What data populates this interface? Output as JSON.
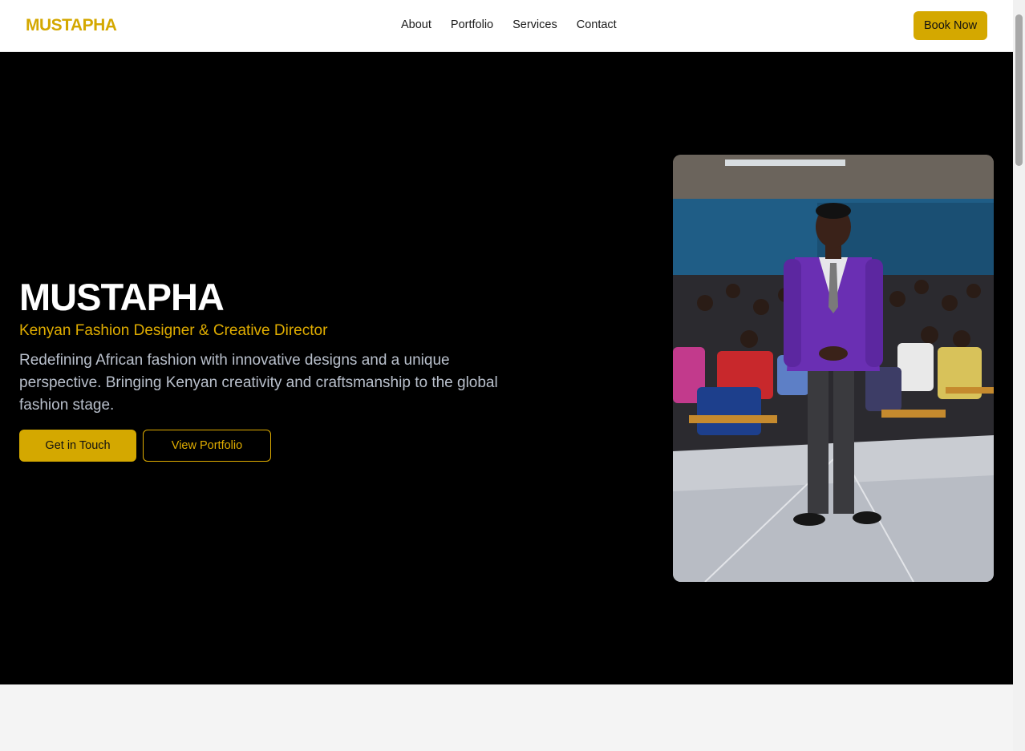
{
  "header": {
    "logo": "MUSTAPHA",
    "nav": [
      "About",
      "Portfolio",
      "Services",
      "Contact"
    ],
    "cta": "Book Now"
  },
  "hero": {
    "title": "MUSTAPHA",
    "subtitle": "Kenyan Fashion Designer & Creative Director",
    "description": "Redefining African fashion with innovative designs and a unique perspective. Bringing Kenyan creativity and craftsmanship to the global fashion stage.",
    "primary_button": "Get in Touch",
    "secondary_button": "View Portfolio"
  },
  "colors": {
    "accent": "#d4a800",
    "hero_bg": "#000000",
    "section_bg": "#f4f4f4"
  }
}
